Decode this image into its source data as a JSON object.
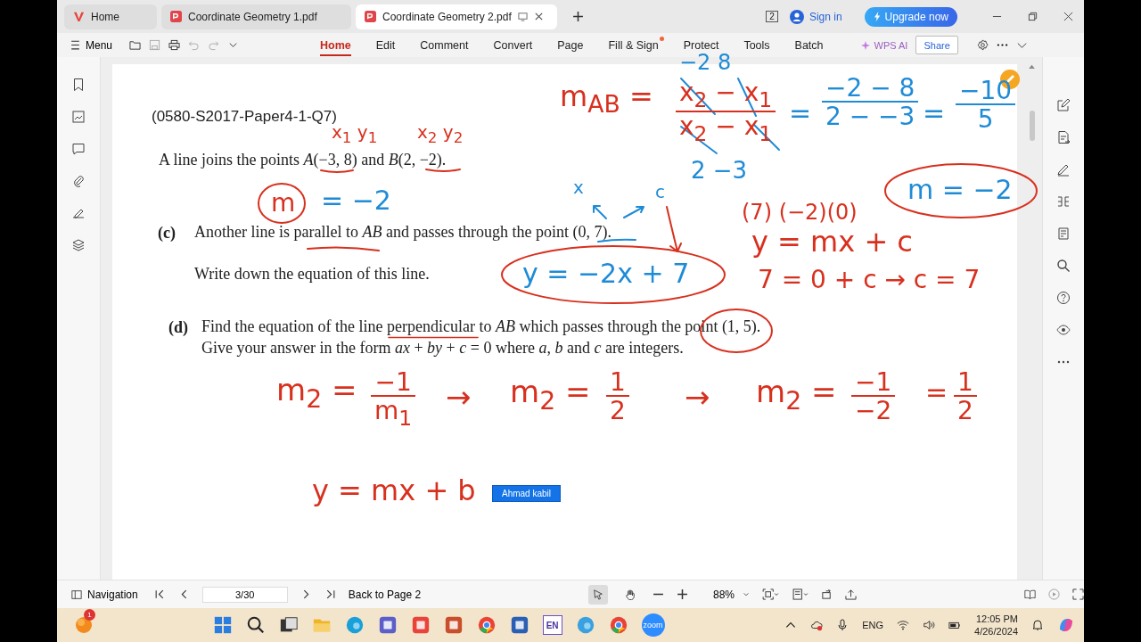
{
  "tabs": [
    {
      "label": "Home",
      "kind": "home",
      "selected": false
    },
    {
      "label": "Coordinate Geometry 1.pdf",
      "kind": "pdf",
      "selected": false
    },
    {
      "label": "Coordinate Geometry 2.pdf",
      "kind": "pdf",
      "selected": true
    }
  ],
  "window_badge": "2",
  "sign_in": "Sign in",
  "upgrade": "Upgrade now",
  "menu": "Menu",
  "ribbon": [
    {
      "label": "Home",
      "selected": true,
      "dot": false
    },
    {
      "label": "Edit",
      "selected": false,
      "dot": false
    },
    {
      "label": "Comment",
      "selected": false,
      "dot": false
    },
    {
      "label": "Convert",
      "selected": false,
      "dot": false
    },
    {
      "label": "Page",
      "selected": false,
      "dot": false
    },
    {
      "label": "Fill & Sign",
      "selected": false,
      "dot": true
    },
    {
      "label": "Protect",
      "selected": false,
      "dot": false
    },
    {
      "label": "Tools",
      "selected": false,
      "dot": false
    },
    {
      "label": "Batch",
      "selected": false,
      "dot": false
    }
  ],
  "wps_ai": "WPS AI",
  "share": "Share",
  "document": {
    "code": "(0580-S2017-Paper4-1-Q7)",
    "intro": "A line joins the points *A*(−3, 8) and *B*(2, −2).",
    "parts": [
      {
        "label": "(c)",
        "lines": [
          "Another line is parallel to *AB* and passes through the point (0, 7)."
        ],
        "follow": "Write down the equation of this line."
      },
      {
        "label": "(d)",
        "lines": [
          "Find the equation of the line perpendicular to *AB* which passes through the point (1, 5).",
          "Give your answer in the form *ax* + *by* + *c* = 0 where *a*, *b* and *c* are integers."
        ]
      }
    ]
  },
  "ink": [
    {
      "kind": "text",
      "color": "#d8301e",
      "text": "m$_{AB}$ ="
    },
    {
      "kind": "text",
      "color": "#1f8bd6",
      "text": "−2    8"
    },
    {
      "kind": "fraction",
      "color": "#d8301e",
      "numerator": "x$_{2}$ − x$_{1}$",
      "denominator": "x$_{2}$ − x$_{1}$"
    },
    {
      "kind": "text",
      "color": "#1f8bd6",
      "text": "="
    },
    {
      "kind": "fraction",
      "color": "#1f8bd6",
      "numerator": "−2 − 8",
      "denominator": "2 − −3"
    },
    {
      "kind": "text",
      "color": "#1f8bd6",
      "text": "="
    },
    {
      "kind": "fraction",
      "color": "#1f8bd6",
      "numerator": "−10",
      "denominator": "5"
    },
    {
      "kind": "text",
      "color": "#d8301e",
      "text": "x$_{1}$ y$_{1}$"
    },
    {
      "kind": "text",
      "color": "#d8301e",
      "text": "x$_{2}$ y$_{2}$"
    },
    {
      "kind": "text",
      "color": "#1f8bd6",
      "text": "2    −3"
    },
    {
      "kind": "text",
      "color": "#1f8bd6",
      "text": "m = −2"
    },
    {
      "kind": "text",
      "color": "#d8301e",
      "text": "m"
    },
    {
      "kind": "text",
      "color": "#1f8bd6",
      "text": "= −2"
    },
    {
      "kind": "text",
      "color": "#1f8bd6",
      "text": "x"
    },
    {
      "kind": "text",
      "color": "#1f8bd6",
      "text": "c"
    },
    {
      "kind": "text",
      "color": "#d8301e",
      "text": "(7)  (−2)(0)"
    },
    {
      "kind": "text",
      "color": "#d8301e",
      "text": "y = mx + c"
    },
    {
      "kind": "text",
      "color": "#1f8bd6",
      "text": "y = −2x + 7"
    },
    {
      "kind": "text",
      "color": "#d8301e",
      "text": "7 = 0 + c → c = 7"
    },
    {
      "kind": "text",
      "color": "#d8301e",
      "text": "m$_{2}$ ="
    },
    {
      "kind": "fraction",
      "color": "#d8301e",
      "numerator": "−1",
      "denominator": "m$_{1}$"
    },
    {
      "kind": "text",
      "color": "#d8301e",
      "text": "→"
    },
    {
      "kind": "text",
      "color": "#d8301e",
      "text": "m$_{2}$ ="
    },
    {
      "kind": "fraction",
      "color": "#d8301e",
      "numerator": "1",
      "denominator": "2"
    },
    {
      "kind": "text",
      "color": "#d8301e",
      "text": "→"
    },
    {
      "kind": "text",
      "color": "#d8301e",
      "text": "m$_{2}$ ="
    },
    {
      "kind": "fraction",
      "color": "#d8301e",
      "numerator": "−1",
      "denominator": "−2"
    },
    {
      "kind": "text",
      "color": "#d8301e",
      "text": "="
    },
    {
      "kind": "fraction",
      "color": "#d8301e",
      "numerator": "1",
      "denominator": "2"
    },
    {
      "kind": "text",
      "color": "#d8301e",
      "text": "y = mx + b"
    }
  ],
  "name_tag": "Ahmad kabil",
  "navigation": "Navigation",
  "page_field": "3/30",
  "back": "Back to Page 2",
  "tools": [
    {
      "kind": "select",
      "selected": true
    },
    {
      "kind": "hand",
      "selected": false
    }
  ],
  "zoom": "88%",
  "taskbar": {
    "notification_count": "1",
    "en_label": "EN",
    "zoom_label": "zoom",
    "language": "ENG",
    "time": "12:05 PM",
    "date": "4/26/2024"
  }
}
